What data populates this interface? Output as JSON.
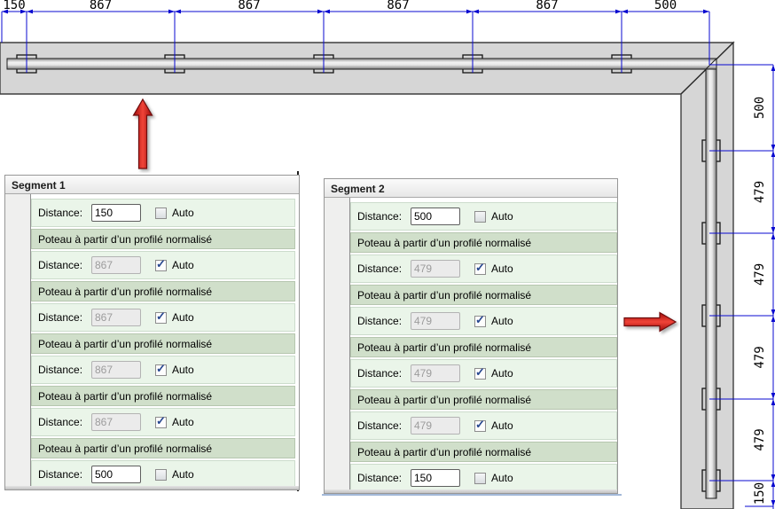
{
  "drawing": {
    "top_dimension_labels": [
      "150",
      "867",
      "867",
      "867",
      "867",
      "500"
    ],
    "right_dimension_labels": [
      "500",
      "479",
      "479",
      "479",
      "479",
      "150"
    ],
    "colors": {
      "dimension_blue": "#0808d0",
      "band_fill": "#d6d6d6",
      "band_stroke": "#3f3f3f",
      "arrow_red_dark": "#9e0b0b",
      "arrow_red_light": "#f04438"
    }
  },
  "strings": {
    "distance_label": "Distance:",
    "auto_label": "Auto",
    "post_label": "Poteau à partir d’un profilé normalisé"
  },
  "icons": {
    "check_glyph": "✓"
  },
  "panels": [
    {
      "title": "Segment 1",
      "rows": [
        {
          "type": "distance",
          "value": "150",
          "auto": false,
          "enabled": true
        },
        {
          "type": "post"
        },
        {
          "type": "distance",
          "value": "867",
          "auto": true,
          "enabled": false
        },
        {
          "type": "post"
        },
        {
          "type": "distance",
          "value": "867",
          "auto": true,
          "enabled": false
        },
        {
          "type": "post"
        },
        {
          "type": "distance",
          "value": "867",
          "auto": true,
          "enabled": false
        },
        {
          "type": "post"
        },
        {
          "type": "distance",
          "value": "867",
          "auto": true,
          "enabled": false
        },
        {
          "type": "post"
        },
        {
          "type": "distance",
          "value": "500",
          "auto": false,
          "enabled": true
        }
      ]
    },
    {
      "title": "Segment 2",
      "rows": [
        {
          "type": "distance",
          "value": "500",
          "auto": false,
          "enabled": true
        },
        {
          "type": "post"
        },
        {
          "type": "distance",
          "value": "479",
          "auto": true,
          "enabled": false
        },
        {
          "type": "post"
        },
        {
          "type": "distance",
          "value": "479",
          "auto": true,
          "enabled": false
        },
        {
          "type": "post"
        },
        {
          "type": "distance",
          "value": "479",
          "auto": true,
          "enabled": false
        },
        {
          "type": "post"
        },
        {
          "type": "distance",
          "value": "479",
          "auto": true,
          "enabled": false
        },
        {
          "type": "post"
        },
        {
          "type": "distance",
          "value": "150",
          "auto": false,
          "enabled": true
        }
      ]
    }
  ]
}
